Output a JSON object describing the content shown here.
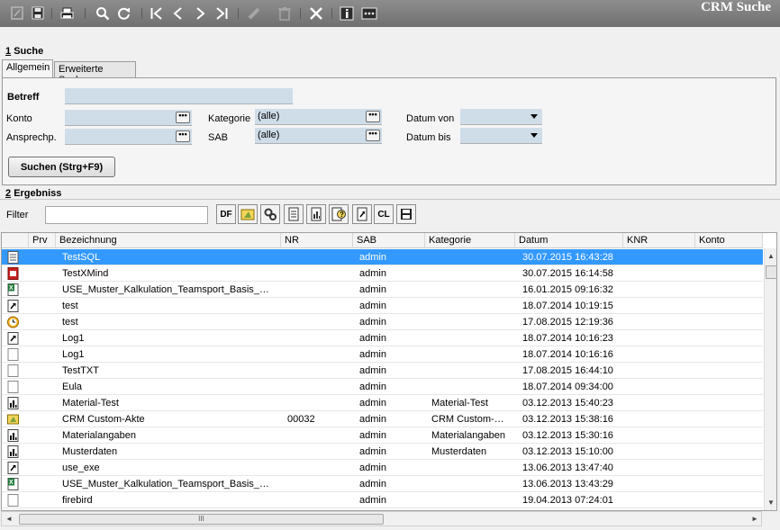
{
  "app_title": "CRM Suche",
  "toolbar": {
    "icons": [
      "edit-icon",
      "save-icon",
      "print-icon",
      "search-icon",
      "refresh-icon",
      "first-record-icon",
      "previous-record-icon",
      "next-record-icon",
      "last-record-icon",
      "pencil-icon",
      "delete-icon",
      "close-icon",
      "info-icon",
      "more-icon"
    ]
  },
  "search_section": {
    "number": "1",
    "title": "Suche",
    "tabs": [
      "Allgemein",
      "Erweiterte Suche"
    ],
    "fields": {
      "betreff_label": "Betreff",
      "konto_label": "Konto",
      "ansprechp_label": "Ansprechp.",
      "kategorie_label": "Kategorie",
      "kategorie_value": "(alle)",
      "sab_label": "SAB",
      "sab_value": "(alle)",
      "datum_von_label": "Datum von",
      "datum_bis_label": "Datum bis"
    },
    "dots_label": "•••",
    "search_button": "Suchen (Strg+F9)"
  },
  "results_section": {
    "number": "2",
    "title": "Ergebniss",
    "filter_label": "Filter",
    "buttons": {
      "df": "DF",
      "cl": "CL"
    }
  },
  "grid": {
    "columns": [
      "Prv",
      "Bezeichnung",
      "NR",
      "SAB",
      "Kategorie",
      "Datum",
      "KNR",
      "Konto"
    ],
    "rows": [
      {
        "icon": "text-doc-icon",
        "bezeichnung": "TestSQL",
        "nr": "",
        "sab": "admin",
        "kategorie": "",
        "datum": "30.07.2015 16:43:28",
        "selected": true
      },
      {
        "icon": "pdf-icon",
        "bezeichnung": "TestXMind",
        "nr": "",
        "sab": "admin",
        "kategorie": "",
        "datum": "30.07.2015 16:14:58",
        "selected": false
      },
      {
        "icon": "excel-icon",
        "bezeichnung": "USE_Muster_Kalkulation_Teamsport_Basis_US...",
        "nr": "",
        "sab": "admin",
        "kategorie": "",
        "datum": "16.01.2015 09:16:32",
        "selected": false
      },
      {
        "icon": "shortcut-icon",
        "bezeichnung": "test",
        "nr": "",
        "sab": "admin",
        "kategorie": "",
        "datum": "18.07.2014 10:19:15",
        "selected": false
      },
      {
        "icon": "clock-icon",
        "bezeichnung": "test",
        "nr": "",
        "sab": "admin",
        "kategorie": "",
        "datum": "17.08.2015 12:19:36",
        "selected": false
      },
      {
        "icon": "shortcut-icon",
        "bezeichnung": "Log1",
        "nr": "",
        "sab": "admin",
        "kategorie": "",
        "datum": "18.07.2014 10:16:23",
        "selected": false
      },
      {
        "icon": "blank-doc-icon",
        "bezeichnung": "Log1",
        "nr": "",
        "sab": "admin",
        "kategorie": "",
        "datum": "18.07.2014 10:16:16",
        "selected": false
      },
      {
        "icon": "blank-doc-icon",
        "bezeichnung": "TestTXT",
        "nr": "",
        "sab": "admin",
        "kategorie": "",
        "datum": "17.08.2015 16:44:10",
        "selected": false
      },
      {
        "icon": "blank-doc-icon",
        "bezeichnung": "Eula",
        "nr": "",
        "sab": "admin",
        "kategorie": "",
        "datum": "18.07.2014 09:34:00",
        "selected": false
      },
      {
        "icon": "chart-doc-icon",
        "bezeichnung": "Material-Test",
        "nr": "",
        "sab": "admin",
        "kategorie": "Material-Test",
        "datum": "03.12.2013 15:40:23",
        "selected": false
      },
      {
        "icon": "crm-file-icon",
        "bezeichnung": " CRM Custom-Akte",
        "nr": "00032",
        "sab": "admin",
        "kategorie": " CRM Custom-A...",
        "datum": "03.12.2013 15:38:16",
        "selected": false
      },
      {
        "icon": "chart-doc-icon",
        "bezeichnung": "Materialangaben",
        "nr": "",
        "sab": "admin",
        "kategorie": "Materialangaben",
        "datum": "03.12.2013 15:30:16",
        "selected": false
      },
      {
        "icon": "chart-doc-icon",
        "bezeichnung": "Musterdaten",
        "nr": "",
        "sab": "admin",
        "kategorie": "Musterdaten",
        "datum": "03.12.2013 15:10:00",
        "selected": false
      },
      {
        "icon": "shortcut-icon",
        "bezeichnung": "use_exe",
        "nr": "",
        "sab": "admin",
        "kategorie": "",
        "datum": "13.06.2013 13:47:40",
        "selected": false
      },
      {
        "icon": "excel-icon",
        "bezeichnung": "USE_Muster_Kalkulation_Teamsport_Basis_US...",
        "nr": "",
        "sab": "admin",
        "kategorie": "",
        "datum": "13.06.2013 13:43:29",
        "selected": false
      },
      {
        "icon": "blank-doc-icon",
        "bezeichnung": "firebird",
        "nr": "",
        "sab": "admin",
        "kategorie": "",
        "datum": "19.04.2013 07:24:01",
        "selected": false
      }
    ]
  },
  "scrollbar": {
    "grip": "III",
    "up": "▲",
    "down": "▼",
    "left": "◄",
    "right": "►"
  },
  "colors": {
    "selection": "#3399ff",
    "field_bg": "#cfdde9",
    "toolbar_bg": "#7a7a7a"
  }
}
